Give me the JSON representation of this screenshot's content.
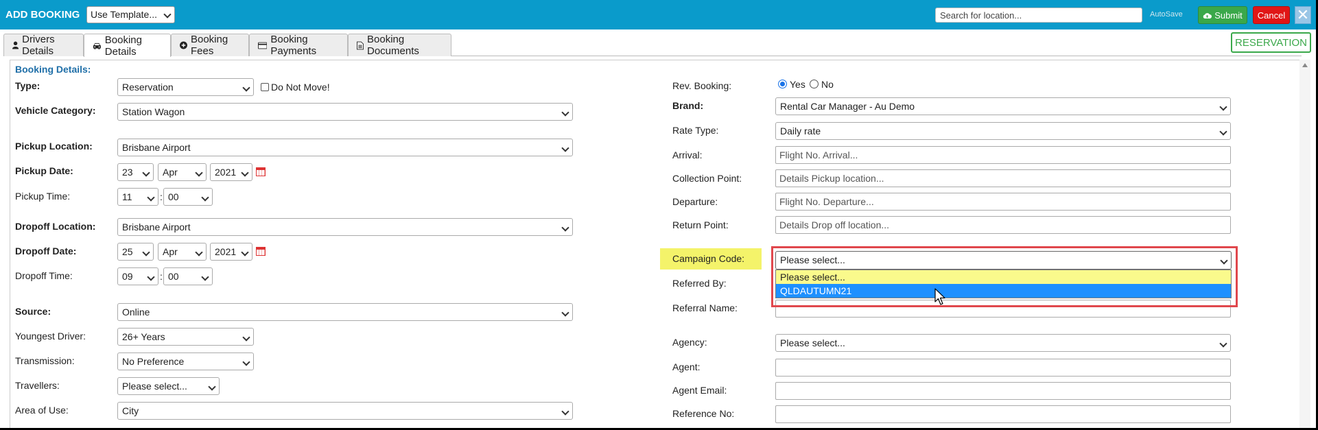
{
  "header": {
    "title": "ADD BOOKING",
    "template_select": "Use Template...",
    "search_placeholder": "Search for location...",
    "autosave": "AutoSave",
    "submit": "Submit",
    "cancel": "Cancel",
    "close": "✕"
  },
  "tabs": [
    {
      "label": "Drivers Details",
      "icon": "user-icon"
    },
    {
      "label": "Booking Details",
      "icon": "car-icon"
    },
    {
      "label": "Booking Fees",
      "icon": "plus-circle-icon"
    },
    {
      "label": "Booking Payments",
      "icon": "credit-card-icon"
    },
    {
      "label": "Booking Documents",
      "icon": "document-icon"
    }
  ],
  "status_badge": "RESERVATION",
  "section_title": "Booking Details:",
  "left": {
    "type_label": "Type:",
    "type_value": "Reservation",
    "do_not_move": "Do Not Move!",
    "vehicle_category_label": "Vehicle Category:",
    "vehicle_category_value": "Station Wagon",
    "pickup_location_label": "Pickup Location:",
    "pickup_location_value": "Brisbane Airport",
    "pickup_date_label": "Pickup Date:",
    "pickup_day": "23",
    "pickup_month": "Apr",
    "pickup_year": "2021",
    "pickup_time_label": "Pickup Time:",
    "pickup_hour": "11",
    "pickup_min": "00",
    "dropoff_location_label": "Dropoff Location:",
    "dropoff_location_value": "Brisbane Airport",
    "dropoff_date_label": "Dropoff Date:",
    "dropoff_day": "25",
    "dropoff_month": "Apr",
    "dropoff_year": "2021",
    "dropoff_time_label": "Dropoff Time:",
    "dropoff_hour": "09",
    "dropoff_min": "00",
    "source_label": "Source:",
    "source_value": "Online",
    "youngest_driver_label": "Youngest Driver:",
    "youngest_driver_value": "26+ Years",
    "transmission_label": "Transmission:",
    "transmission_value": "No Preference",
    "travellers_label": "Travellers:",
    "travellers_value": "Please select...",
    "area_of_use_label": "Area of Use:",
    "area_of_use_value": "City",
    "colon": ":"
  },
  "right": {
    "rev_booking_label": "Rev. Booking:",
    "yes": "Yes",
    "no": "No",
    "brand_label": "Brand:",
    "brand_value": "Rental Car Manager - Au Demo",
    "rate_type_label": "Rate Type:",
    "rate_type_value": "Daily rate",
    "arrival_label": "Arrival:",
    "arrival_placeholder": "Flight No. Arrival...",
    "collection_label": "Collection Point:",
    "collection_placeholder": "Details Pickup location...",
    "departure_label": "Departure:",
    "departure_placeholder": "Flight No. Departure...",
    "return_label": "Return Point:",
    "return_placeholder": "Details Drop off location...",
    "campaign_label": "Campaign Code:",
    "campaign_value": "Please select...",
    "campaign_options": [
      "Please select...",
      "QLDAUTUMN21"
    ],
    "referred_by_label": "Referred By:",
    "referral_name_label": "Referral Name:",
    "agency_label": "Agency:",
    "agency_value": "Please select...",
    "agent_label": "Agent:",
    "agent_email_label": "Agent Email:",
    "reference_no_label": "Reference No:"
  },
  "colors": {
    "header": "#0a9bcb",
    "submit": "#3aa84a",
    "cancel": "#e01616",
    "highlight": "#f4f36a",
    "selected_option": "#1e90ff"
  }
}
